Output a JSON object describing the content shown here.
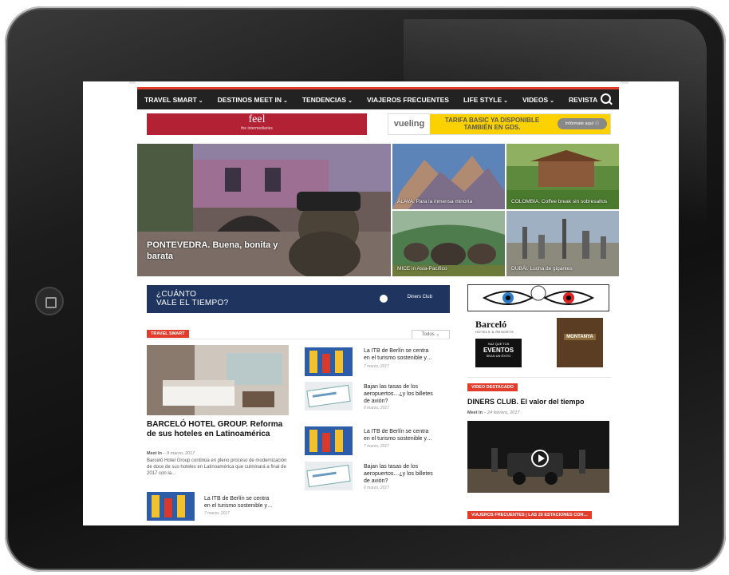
{
  "nav": {
    "items": [
      {
        "label": "TRAVEL SMART",
        "chev": "⌄"
      },
      {
        "label": "DESTINOS MEET IN",
        "chev": "⌄"
      },
      {
        "label": "TENDENCIAS",
        "chev": "⌄"
      },
      {
        "label": "VIAJEROS FRECUENTES",
        "chev": ""
      },
      {
        "label": "LIFE STYLE",
        "chev": "⌄"
      },
      {
        "label": "VIDEOS",
        "chev": "⌄"
      },
      {
        "label": "REVISTA",
        "chev": ""
      }
    ]
  },
  "ads": {
    "feel_title": "feel",
    "feel_sub": "the intermediaries",
    "vueling_logo": "vueling",
    "vueling_promo": "TARIFA BASIC YA DISPONIBLE TAMBIÉN EN GDS.",
    "vueling_cta": "Infórmate aquí ⓘ",
    "diners_q1": "¿CUÁNTO",
    "diners_q2": "VALE EL TIEMPO?",
    "diners_brand": "Diners Club",
    "barcelo_name": "Barceló",
    "barcelo_sub": "HOTELS & RESORTS",
    "barcelo_box1": "HAZ QUE TUS",
    "barcelo_box2": "EVENTOS",
    "barcelo_box3": "SEAN UN ÉXITO",
    "montanya": "MONTANYA"
  },
  "hero": {
    "main": "PONTEVEDRA. Buena, bonita y barata",
    "t1": "ÁLAVA. Para la inmensa minoría",
    "t2": "COLOMBIA. Coffee break sin sobresaltos",
    "t3": "MICE in Asia-Pacífico",
    "t4": "DUBÁI. Lucha de gigantes"
  },
  "section": {
    "badge": "TRAVEL SMART",
    "dropdown": "Todos ⌄",
    "featured_title": "BARCELÓ HOTEL GROUP. Reforma de sus hoteles en Latinoamérica",
    "featured_author": "Meet In",
    "featured_date": " – 8 marzo, 2017",
    "featured_excerpt": "Barceló Hotel Group continúa en pleno proceso de modernización de doce de sus hoteles en Latinoamérica que culminará a final de 2017 con la…",
    "small": [
      {
        "title": "La ITB de Berlín se centra en el turismo sostenible y…",
        "date": "7 marzo, 2017"
      },
      {
        "title": "Bajan las tasas de los aeropuertos…¿y los billetes de avión?",
        "date": "6 marzo, 2017"
      },
      {
        "title": "La ITB de Berlín se centra en el turismo sostenible y…",
        "date": "7 marzo, 2017"
      },
      {
        "title": "Bajan las tasas de los aeropuertos…¿y los billetes de avión?",
        "date": "6 marzo, 2017"
      },
      {
        "title": "La ITB de Berlín se centra en el turismo sostenible y…",
        "date": "7 marzo, 2017"
      }
    ]
  },
  "sidebar": {
    "video_badge": "VIDEO DESTACADO",
    "video_title": "DINERS CLUB. El valor del tiempo",
    "video_author": "Meet In",
    "video_date": " – 24 febrero, 2017",
    "viajeros_badge": "VIAJEROS FRECUENTES | LAS 20 ESTACIONES CON…"
  }
}
